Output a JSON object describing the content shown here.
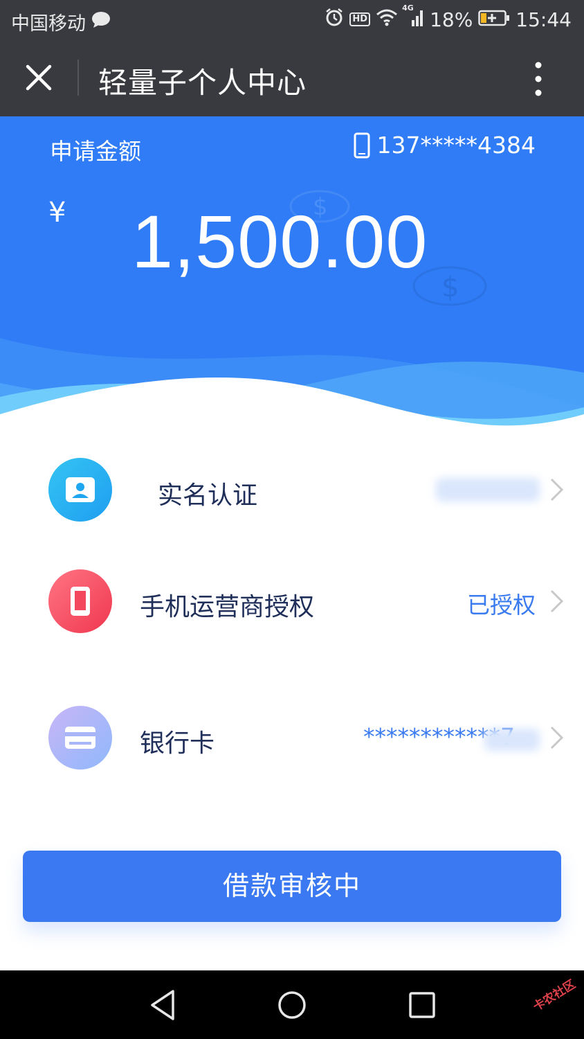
{
  "status_bar": {
    "carrier": "中国移动",
    "network": "4G",
    "battery": "18%",
    "time": "15:44",
    "icons": [
      "message-bubble-icon",
      "alarm-icon",
      "hd-icon",
      "wifi-icon",
      "signal-icon",
      "battery-charging-icon"
    ]
  },
  "title_bar": {
    "title": "轻量子个人中心",
    "close_icon": "close-icon",
    "more_icon": "more-vertical-icon"
  },
  "hero": {
    "amount_label": "申请金额",
    "phone": "137*****4384",
    "currency_symbol": "¥",
    "amount": "1,500.00",
    "background_color": "#2f7cf6"
  },
  "items": [
    {
      "label": "实名认证",
      "value": "",
      "icon": "id-card-icon",
      "colors": [
        "#34c4f3",
        "#1f9ef0"
      ]
    },
    {
      "label": "手机运营商授权",
      "value": "已授权",
      "icon": "phone-icon",
      "colors": [
        "#ff7584",
        "#f0374f"
      ]
    },
    {
      "label": "银行卡",
      "value": "************7",
      "icon": "bank-card-icon",
      "colors": [
        "#c8b6f7",
        "#8fb8fb"
      ]
    }
  ],
  "submit": {
    "label": "借款审核中",
    "color": "#3a79f2"
  },
  "nav_bar": {
    "buttons": [
      "back-icon",
      "home-icon",
      "recents-icon"
    ],
    "watermark": "卡农社区"
  }
}
